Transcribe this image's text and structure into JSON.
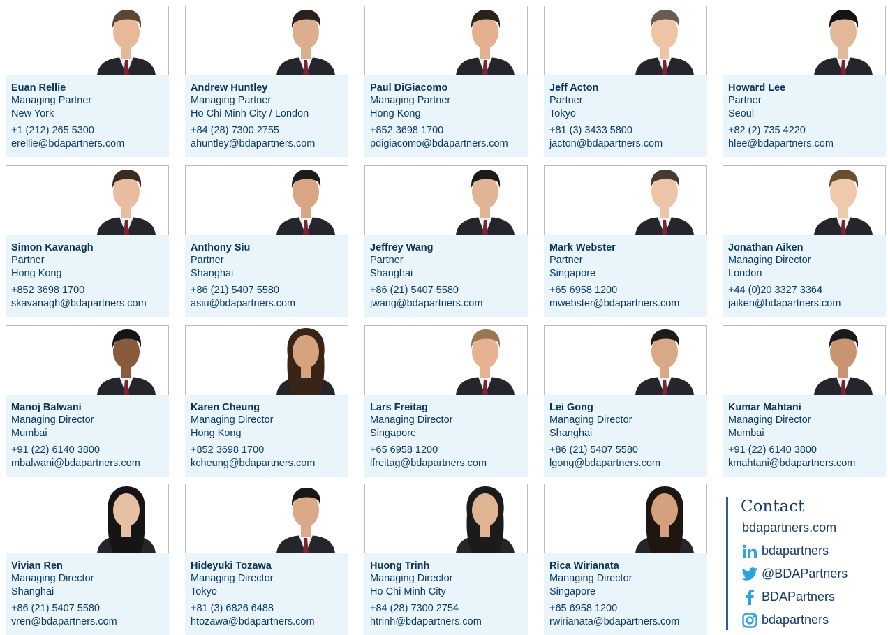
{
  "people": [
    {
      "name": "Euan Rellie",
      "title": "Managing Partner",
      "city": "New York",
      "phone": "+1 (212) 265 5300",
      "email": "erellie@bdapartners.com"
    },
    {
      "name": "Andrew Huntley",
      "title": "Managing Partner",
      "city": "Ho Chi Minh City / London",
      "phone": "+84 (28) 7300 2755",
      "email": "ahuntley@bdapartners.com"
    },
    {
      "name": "Paul DiGiacomo",
      "title": "Managing Partner",
      "city": "Hong Kong",
      "phone": "+852 3698 1700",
      "email": "pdigiacomo@bdapartners.com"
    },
    {
      "name": "Jeff Acton",
      "title": "Partner",
      "city": "Tokyo",
      "phone": "+81 (3) 3433 5800",
      "email": "jacton@bdapartners.com"
    },
    {
      "name": "Howard Lee",
      "title": "Partner",
      "city": "Seoul",
      "phone": "+82 (2) 735 4220",
      "email": "hlee@bdapartners.com"
    },
    {
      "name": "Simon Kavanagh",
      "title": "Partner",
      "city": "Hong Kong",
      "phone": "+852 3698 1700",
      "email": "skavanagh@bdapartners.com"
    },
    {
      "name": "Anthony Siu",
      "title": "Partner",
      "city": "Shanghai",
      "phone": "+86 (21) 5407 5580",
      "email": "asiu@bdapartners.com"
    },
    {
      "name": "Jeffrey Wang",
      "title": "Partner",
      "city": "Shanghai",
      "phone": "+86 (21) 5407 5580",
      "email": "jwang@bdapartners.com"
    },
    {
      "name": "Mark Webster",
      "title": "Partner",
      "city": "Singapore",
      "phone": "+65 6958 1200",
      "email": "mwebster@bdapartners.com"
    },
    {
      "name": "Jonathan Aiken",
      "title": "Managing Director",
      "city": "London",
      "phone": "+44 (0)20 3327 3364",
      "email": "jaiken@bdapartners.com"
    },
    {
      "name": "Manoj Balwani",
      "title": "Managing Director",
      "city": "Mumbai",
      "phone": "+91 (22) 6140 3800",
      "email": "mbalwani@bdapartners.com"
    },
    {
      "name": "Karen Cheung",
      "title": "Managing Director",
      "city": "Hong Kong",
      "phone": "+852 3698 1700",
      "email": "kcheung@bdapartners.com"
    },
    {
      "name": "Lars Freitag",
      "title": "Managing Director",
      "city": "Singapore",
      "phone": "+65 6958 1200",
      "email": "lfreitag@bdapartners.com"
    },
    {
      "name": "Lei Gong",
      "title": "Managing Director",
      "city": "Shanghai",
      "phone": "+86 (21) 5407 5580",
      "email": "lgong@bdapartners.com"
    },
    {
      "name": "Kumar Mahtani",
      "title": "Managing Director",
      "city": "Mumbai",
      "phone": "+91 (22) 6140 3800",
      "email": "kmahtani@bdapartners.com"
    },
    {
      "name": "Vivian Ren",
      "title": "Managing Director",
      "city": "Shanghai",
      "phone": "+86 (21) 5407 5580",
      "email": "vren@bdapartners.com"
    },
    {
      "name": "Hideyuki Tozawa",
      "title": "Managing Director",
      "city": "Tokyo",
      "phone": "+81 (3) 6826 6488",
      "email": "htozawa@bdapartners.com"
    },
    {
      "name": "Huong Trinh",
      "title": "Managing Director",
      "city": "Ho Chi Minh City",
      "phone": "+84 (28) 7300 2754",
      "email": "htrinh@bdapartners.com"
    },
    {
      "name": "Rica Wirianata",
      "title": "Managing Director",
      "city": "Singapore",
      "phone": "+65 6958 1200",
      "email": "rwirianata@bdapartners.com"
    }
  ],
  "contact": {
    "title": "Contact",
    "website": "bdapartners.com",
    "linkedin": "bdapartners",
    "twitter": "@BDAPartners",
    "facebook": "BDAPartners",
    "instagram": "bdapartners",
    "icons": [
      "linkedin-icon",
      "twitter-icon",
      "facebook-icon",
      "instagram-icon"
    ],
    "accent_color": "#2aa3df",
    "text_color": "#173a6b"
  },
  "colors": {
    "card_bg": "#e9f5fb",
    "name_color": "#0a3358",
    "text_color": "#0b3a66"
  }
}
